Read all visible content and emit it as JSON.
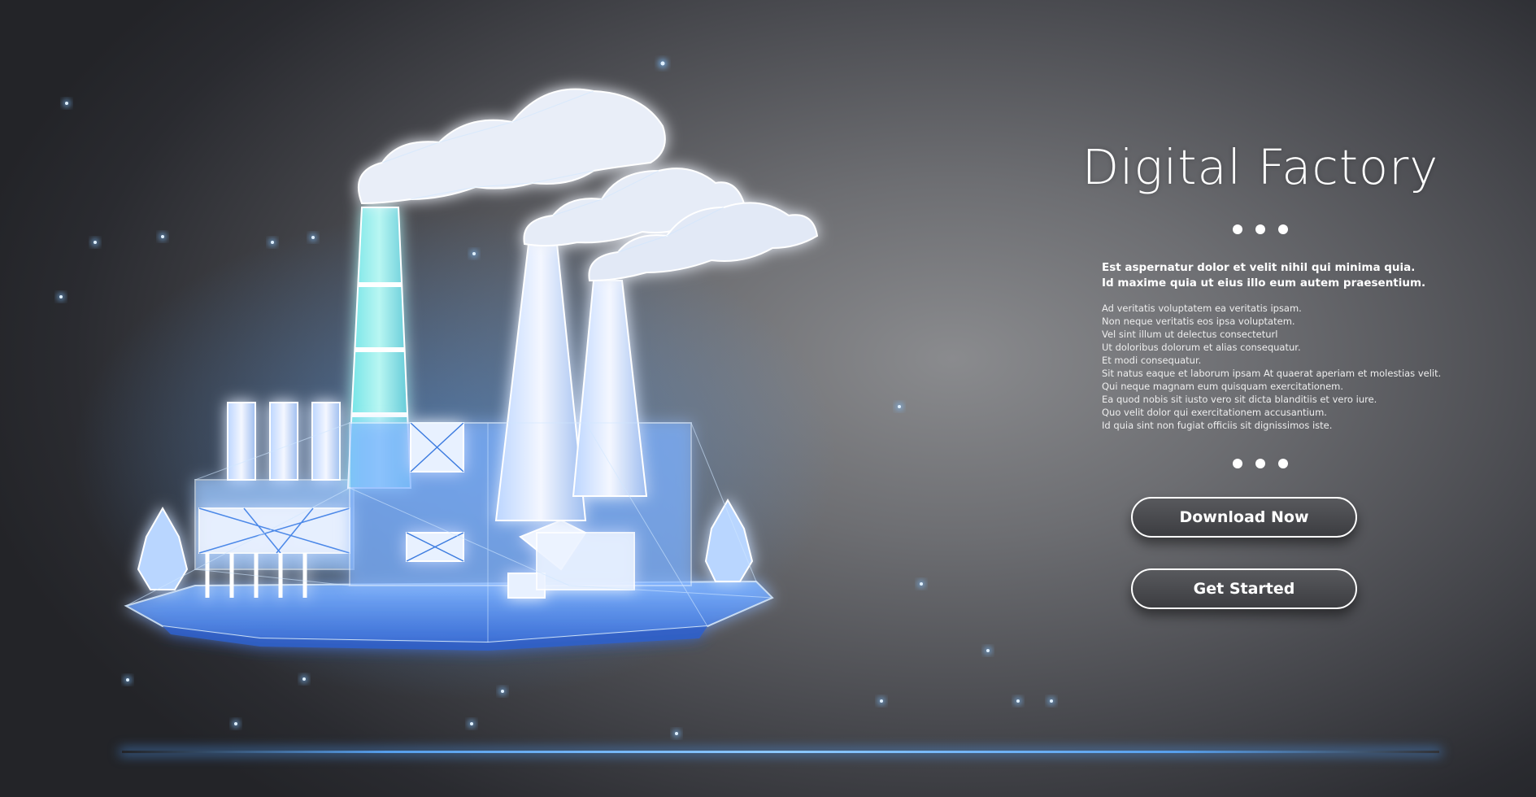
{
  "hero": {
    "title": "Digital Factory",
    "lead_lines": [
      "Est aspernatur dolor et velit nihil qui minima quia.",
      "Id maxime quia ut eius illo eum autem praesentium."
    ],
    "body_lines": [
      "Ad veritatis voluptatem ea veritatis ipsam.",
      "Non neque veritatis eos ipsa voluptatem.",
      "Vel sint illum ut delectus consecteturl",
      "Ut doloribus dolorum et alias consequatur.",
      "Et modi consequatur.",
      "Sit natus eaque et laborum ipsam At quaerat aperiam et molestias velit.",
      "Qui neque magnam eum quisquam exercitationem.",
      "Ea quod nobis sit iusto vero sit dicta blanditiis et vero iure.",
      "Quo velit dolor qui exercitationem accusantium.",
      "Id quia sint non fugiat officiis sit dignissimos iste."
    ]
  },
  "buttons": {
    "download_label": "Download Now",
    "started_label": "Get Started"
  },
  "illustration": {
    "icon": "low-poly-factory-illustration",
    "glow_color": "#3f9bff",
    "smoke_color": "#e8eef8"
  }
}
